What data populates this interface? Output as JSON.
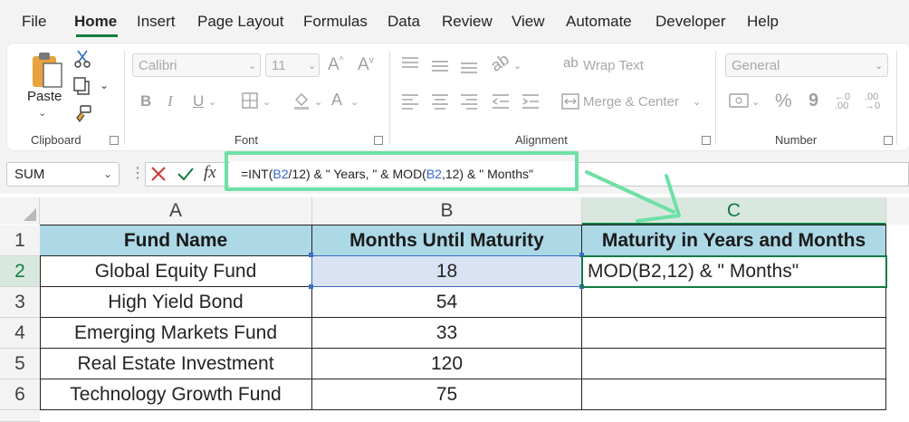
{
  "menu": [
    "File",
    "Home",
    "Insert",
    "Page Layout",
    "Formulas",
    "Data",
    "Review",
    "View",
    "Automate",
    "Developer",
    "Help"
  ],
  "ribbon": {
    "paste_label": "Paste",
    "clipboard_label": "Clipboard",
    "font_name": "Calibri",
    "font_size": "11",
    "font_label": "Font",
    "wrap_text": "Wrap Text",
    "merge_center": "Merge & Center",
    "alignment_label": "Alignment",
    "number_format": "General",
    "number_label": "Number",
    "bold": "B",
    "italic": "I",
    "underline": "U",
    "percent": "%",
    "comma": "9"
  },
  "formula_bar": {
    "name_box": "SUM",
    "fx": "fx",
    "formula_parts": [
      "=INT(",
      "B2",
      "/12) & \" Years, \" & MOD(",
      "B2",
      ",12) & \" Months\""
    ]
  },
  "sheet": {
    "columns": [
      "A",
      "B",
      "C"
    ],
    "rows": [
      "1",
      "2",
      "3",
      "4",
      "5",
      "6"
    ],
    "headers": [
      "Fund Name",
      "Months Until Maturity",
      "Maturity in Years and Months"
    ],
    "data": [
      {
        "fund": "Global Equity Fund",
        "months": "18",
        "result": "MOD(B2,12) & \" Months\""
      },
      {
        "fund": "High Yield Bond",
        "months": "54",
        "result": ""
      },
      {
        "fund": "Emerging Markets Fund",
        "months": "33",
        "result": ""
      },
      {
        "fund": "Real Estate Investment",
        "months": "120",
        "result": ""
      },
      {
        "fund": "Technology Growth Fund",
        "months": "75",
        "result": ""
      }
    ]
  },
  "colors": {
    "accent": "#107c41",
    "header_fill": "#add8e6",
    "selected_fill": "#dae3f3",
    "callout": "#6ee0a6",
    "ref": "#3366cc"
  }
}
